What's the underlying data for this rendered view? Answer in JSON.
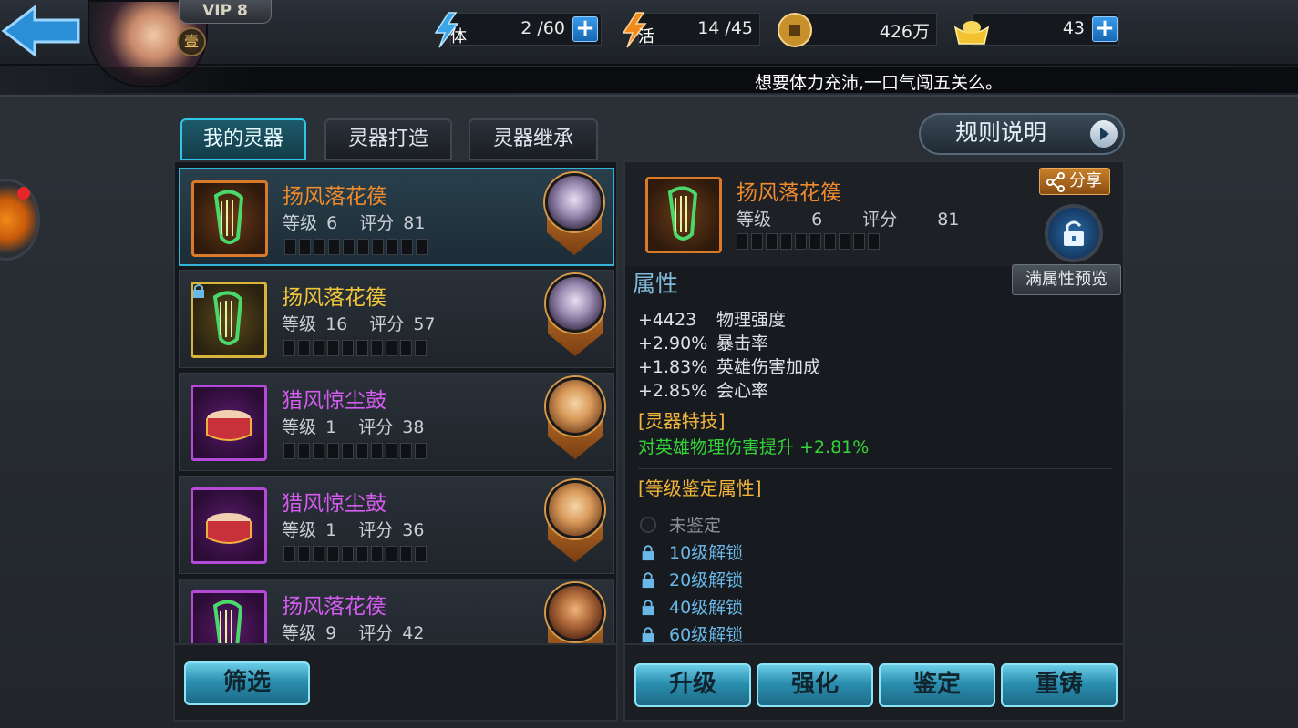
{
  "header": {
    "vip_label": "VIP 8",
    "rank_glyph": "壹",
    "resources": [
      {
        "name": "stamina",
        "glyph": "体",
        "value": "2 /60",
        "has_plus": true
      },
      {
        "name": "vitality",
        "glyph": "活",
        "value": "14 /45",
        "has_plus": false
      },
      {
        "name": "coins",
        "glyph": "",
        "value": "426万",
        "has_plus": false
      },
      {
        "name": "gold",
        "glyph": "",
        "value": "43",
        "has_plus": true
      }
    ],
    "ticker": "想要体力充沛,一口气闯五关么。"
  },
  "tabs": [
    {
      "label": "我的灵器",
      "active": true
    },
    {
      "label": "灵器打造",
      "active": false
    },
    {
      "label": "灵器继承",
      "active": false
    }
  ],
  "rules_button": "规则说明",
  "list": {
    "level_label": "等级",
    "score_label": "评分",
    "items": [
      {
        "name": "扬风落花篌",
        "level": "6",
        "score": "81",
        "rarity": "orange",
        "hero": "ghost",
        "locked": false,
        "selected": true
      },
      {
        "name": "扬风落花篌",
        "level": "16",
        "score": "57",
        "rarity": "gold",
        "hero": "ghost",
        "locked": true,
        "selected": false
      },
      {
        "name": "猎风惊尘鼓",
        "level": "1",
        "score": "38",
        "rarity": "purple",
        "hero": "monk",
        "locked": false,
        "selected": false
      },
      {
        "name": "猎风惊尘鼓",
        "level": "1",
        "score": "36",
        "rarity": "purple",
        "hero": "monk",
        "locked": false,
        "selected": false
      },
      {
        "name": "扬风落花篌",
        "level": "9",
        "score": "42",
        "rarity": "purple",
        "hero": "warrior",
        "locked": false,
        "selected": false
      }
    ],
    "filter_button": "筛选"
  },
  "detail": {
    "name": "扬风落花篌",
    "level": "6",
    "score": "81",
    "share_button": "分享",
    "attr_title": "属性",
    "preview_button": "满属性预览",
    "attributes": [
      {
        "value": "+4423",
        "label": "物理强度"
      },
      {
        "value": "+2.90%",
        "label": "暴击率"
      },
      {
        "value": "+1.83%",
        "label": "英雄伤害加成"
      },
      {
        "value": "+2.85%",
        "label": "会心率"
      }
    ],
    "skill_header": "[灵器特技]",
    "skill_text": "对英雄物理伤害提升 +2.81%",
    "identify_header": "[等级鉴定属性]",
    "identify_rows": [
      {
        "text": "未鉴定",
        "state": "pending"
      },
      {
        "text": "10级解锁",
        "state": "locked"
      },
      {
        "text": "20级解锁",
        "state": "locked"
      },
      {
        "text": "40级解锁",
        "state": "locked"
      },
      {
        "text": "60级解锁",
        "state": "locked"
      }
    ]
  },
  "actions": [
    "升级",
    "强化",
    "鉴定",
    "重铸"
  ],
  "colors": {
    "accent": "#2ec6e6",
    "orange_rarity": "#f08a2c",
    "gold_rarity": "#f0c63a",
    "purple_rarity": "#d55cf0",
    "skill_green": "#34d43a",
    "section_gold": "#f0b43a"
  }
}
